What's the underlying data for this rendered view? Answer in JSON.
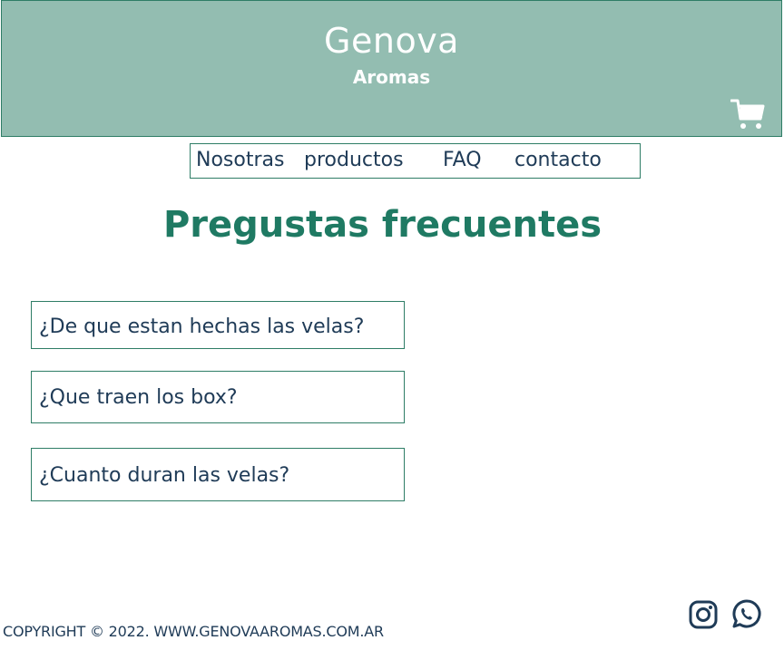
{
  "header": {
    "brand_title": "Genova",
    "brand_subtitle": "Aromas",
    "cart_icon": "shopping-cart-icon",
    "background_color": "#93bdb1"
  },
  "nav": {
    "items": [
      {
        "label": "Nosotras"
      },
      {
        "label": "productos"
      },
      {
        "label": "FAQ"
      },
      {
        "label": "contacto"
      }
    ]
  },
  "main": {
    "title": "Pregustas frecuentes",
    "title_color": "#1f7a63",
    "questions": [
      {
        "label": "¿De que estan hechas las velas?"
      },
      {
        "label": "¿Que traen los box?"
      },
      {
        "label": "¿Cuanto duran las velas?"
      }
    ]
  },
  "footer": {
    "copyright": "COPYRIGHT © 2022. WWW.GENOVAAROMAS.COM.AR",
    "social_icons": [
      "instagram-icon",
      "whatsapp-icon"
    ]
  }
}
